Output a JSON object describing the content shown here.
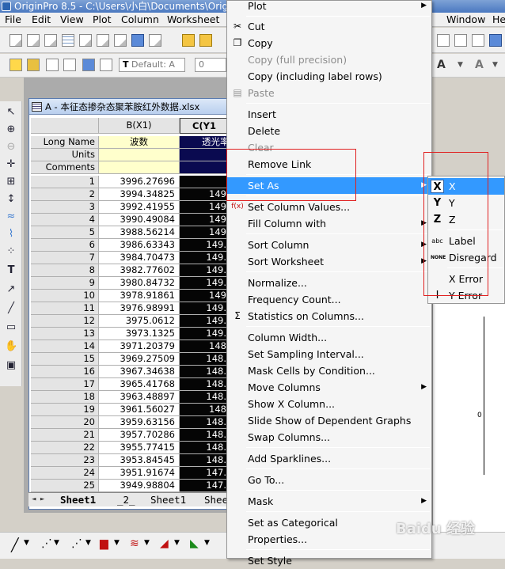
{
  "window": {
    "title": "OriginPro 8.5 - C:\\Users\\小白\\Documents\\Orig"
  },
  "menubar": [
    "File",
    "Edit",
    "View",
    "Plot",
    "Column",
    "Worksheet",
    "Window",
    "He"
  ],
  "toolbar": {
    "font_combo": "Default: A",
    "size_combo": "0"
  },
  "workbook": {
    "title": "A - 本征态掺杂态聚苯胺红外数据.xlsx",
    "col_headers": [
      "B(X1)",
      "C(Y1"
    ],
    "long_name_label": "Long Name",
    "units_label": "Units",
    "comments_label": "Comments",
    "long_name_values": [
      "波数",
      "透光率"
    ],
    "rows": [
      {
        "n": "1",
        "b": "3996.27696",
        "c": ""
      },
      {
        "n": "2",
        "b": "3994.34825",
        "c": "149"
      },
      {
        "n": "3",
        "b": "3992.41955",
        "c": "149"
      },
      {
        "n": "4",
        "b": "3990.49084",
        "c": "149"
      },
      {
        "n": "5",
        "b": "3988.56214",
        "c": "149"
      },
      {
        "n": "6",
        "b": "3986.63343",
        "c": "149."
      },
      {
        "n": "7",
        "b": "3984.70473",
        "c": "149."
      },
      {
        "n": "8",
        "b": "3982.77602",
        "c": "149."
      },
      {
        "n": "9",
        "b": "3980.84732",
        "c": "149."
      },
      {
        "n": "10",
        "b": "3978.91861",
        "c": "149"
      },
      {
        "n": "11",
        "b": "3976.98991",
        "c": "149."
      },
      {
        "n": "12",
        "b": "3975.0612",
        "c": "149."
      },
      {
        "n": "13",
        "b": "3973.1325",
        "c": "149."
      },
      {
        "n": "14",
        "b": "3971.20379",
        "c": "148"
      },
      {
        "n": "15",
        "b": "3969.27509",
        "c": "148."
      },
      {
        "n": "16",
        "b": "3967.34638",
        "c": "148."
      },
      {
        "n": "17",
        "b": "3965.41768",
        "c": "148."
      },
      {
        "n": "18",
        "b": "3963.48897",
        "c": "148."
      },
      {
        "n": "19",
        "b": "3961.56027",
        "c": "148"
      },
      {
        "n": "20",
        "b": "3959.63156",
        "c": "148."
      },
      {
        "n": "21",
        "b": "3957.70286",
        "c": "148."
      },
      {
        "n": "22",
        "b": "3955.77415",
        "c": "148."
      },
      {
        "n": "23",
        "b": "3953.84545",
        "c": "148."
      },
      {
        "n": "24",
        "b": "3951.91674",
        "c": "147."
      },
      {
        "n": "25",
        "b": "3949.98804",
        "c": "147."
      }
    ],
    "sheet_tabs": [
      "Sheet1",
      "_2_",
      "Sheet1",
      "Shee"
    ]
  },
  "context_menu": {
    "items": [
      {
        "label": "Plot",
        "icon": "",
        "arrow": true,
        "disabled": false
      },
      {
        "label": "Cut",
        "icon": "✂",
        "disabled": false
      },
      {
        "label": "Copy",
        "icon": "❐",
        "disabled": false
      },
      {
        "label": "Copy (full precision)",
        "disabled": true
      },
      {
        "label": "Copy (including label rows)",
        "disabled": false
      },
      {
        "label": "Paste",
        "icon": "📋",
        "disabled": true
      },
      {
        "label": "Insert",
        "disabled": false
      },
      {
        "label": "Delete",
        "disabled": false
      },
      {
        "label": "Clear",
        "disabled": true
      },
      {
        "label": "Remove Link",
        "disabled": false
      },
      {
        "label": "Set As",
        "arrow": true,
        "selected": true
      },
      {
        "label": "Set Column Values...",
        "icon": "f(x)"
      },
      {
        "label": "Fill Column with",
        "arrow": true
      },
      {
        "label": "Sort Column",
        "arrow": true
      },
      {
        "label": "Sort Worksheet",
        "arrow": true
      },
      {
        "label": "Normalize..."
      },
      {
        "label": "Frequency Count..."
      },
      {
        "label": "Statistics on Columns...",
        "icon": "Σ"
      },
      {
        "label": "Column Width..."
      },
      {
        "label": "Set Sampling Interval..."
      },
      {
        "label": "Mask Cells by Condition..."
      },
      {
        "label": "Move Columns",
        "arrow": true
      },
      {
        "label": "Show X Column..."
      },
      {
        "label": "Slide Show of Dependent Graphs"
      },
      {
        "label": "Swap Columns..."
      },
      {
        "label": "Add Sparklines..."
      },
      {
        "label": "Go To..."
      },
      {
        "label": "Mask",
        "arrow": true
      },
      {
        "label": "Set as Categorical"
      },
      {
        "label": "Properties..."
      },
      {
        "label": "Set Style"
      }
    ]
  },
  "submenu": {
    "items": [
      {
        "label": "X",
        "icon": "X",
        "selected": true
      },
      {
        "label": "Y",
        "icon": "Y"
      },
      {
        "label": "Z",
        "icon": "Z"
      },
      {
        "label": "Label",
        "icon": "abc"
      },
      {
        "label": "Disregard",
        "icon": "NONE"
      },
      {
        "label": "X Error",
        "icon": ""
      },
      {
        "label": "Y Error",
        "icon": "I"
      }
    ]
  },
  "watermark": "Baidu 经验"
}
